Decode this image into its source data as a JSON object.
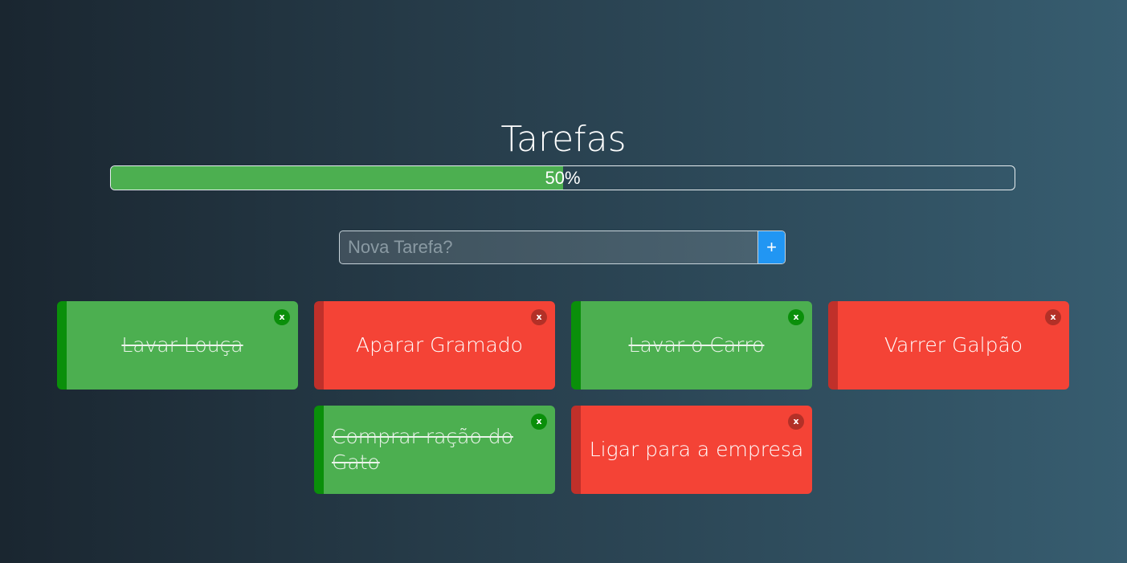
{
  "header": {
    "title": "Tarefas"
  },
  "progress": {
    "value": 0.5,
    "label": "50%",
    "fill_color": "#4caf50"
  },
  "new_task": {
    "placeholder": "Nova Tarefa?",
    "value": "",
    "add_label": "+",
    "add_color": "#2196f3"
  },
  "tasks": [
    {
      "label": "Lavar Louça",
      "status": "done",
      "close_label": "x"
    },
    {
      "label": "Aparar Gramado",
      "status": "pending",
      "close_label": "x"
    },
    {
      "label": "Lavar o Carro",
      "status": "done",
      "close_label": "x"
    },
    {
      "label": "Varrer Galpão",
      "status": "pending",
      "close_label": "x"
    },
    {
      "label": "Comprar ração do Gato",
      "status": "done",
      "close_label": "x"
    },
    {
      "label": "Ligar para a empresa",
      "status": "pending",
      "close_label": "x"
    }
  ],
  "colors": {
    "done": "#4caf50",
    "pending": "#f44336"
  }
}
